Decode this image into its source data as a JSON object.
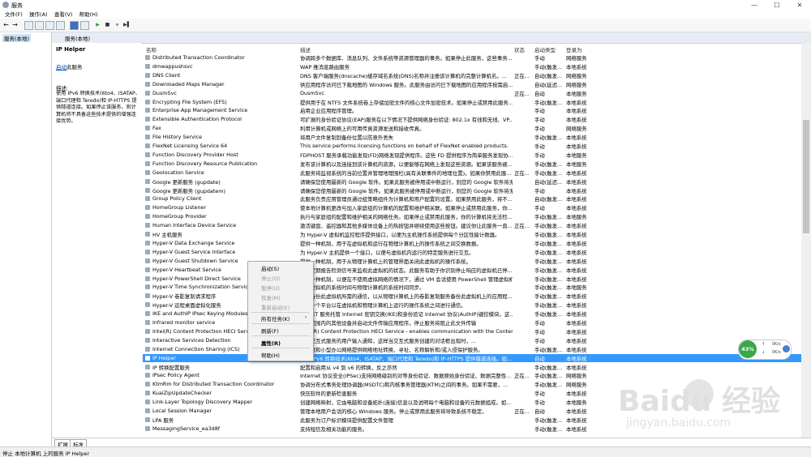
{
  "window": {
    "title": "服务",
    "min": "—",
    "max": "☐",
    "close": "✕"
  },
  "menubar": [
    "文件(F)",
    "操作(A)",
    "查看(V)",
    "帮助(H)"
  ],
  "toolbar": {
    "back": "←",
    "forward": "→",
    "play": "▶",
    "stop": "■",
    "pause": "⏸",
    "restart": "▶▌"
  },
  "tree": {
    "root": "服务(本地)"
  },
  "header": {
    "title": "服务(本地)"
  },
  "desc": {
    "title": "IP Helper",
    "start_link": "启动",
    "start_suffix": "此服务",
    "label": "描述:",
    "body": "使用 IPv6 转换技术(6to4、ISATAP、端口代理和 Teredo)和 IP-HTTPS 提供隧道连接。如果停止该服务，则计算机将不具备这些技术提供的增强连接优势。"
  },
  "columns": {
    "name": "名称",
    "desc": "描述",
    "status": "状态",
    "startup": "启动类型",
    "logon": "登录为"
  },
  "rows": [
    {
      "name": "Distributed Transaction Coordinator",
      "desc": "协调跨多个数据库、消息队列、文件系统等资源管理器的事务。如果停止此服务，这些事务...",
      "status": "",
      "startup": "手动",
      "logon": "网络服务"
    },
    {
      "name": "dmwappushsvc",
      "desc": "WAP 推消息路由服务",
      "status": "",
      "startup": "手动(触发...",
      "logon": "本地系统"
    },
    {
      "name": "DNS Client",
      "desc": "DNS 客户端服务(dnscache)缓存域名系统(DNS)名称并注册该计算机的完整计算机名。...",
      "status": "正在...",
      "startup": "自动(触发...",
      "logon": "网络服务"
    },
    {
      "name": "Downloaded Maps Manager",
      "desc": "供应用程序访问已下载地图的 Windows 服务。此服务由访问已下载地图的应用程序按需启...",
      "status": "",
      "startup": "自动(延迟...",
      "logon": "网络服务"
    },
    {
      "name": "DusmSvc",
      "desc": "DusmSvc",
      "status": "正在...",
      "startup": "自动",
      "logon": "本地服务"
    },
    {
      "name": "Encrypting File System (EFS)",
      "desc": "提供用于在 NTFS 文件系统卷上存储加密文件的核心文件加密技术。如果停止或禁用此服务...",
      "status": "",
      "startup": "手动(触发...",
      "logon": "本地系统"
    },
    {
      "name": "Enterprise App Management Service",
      "desc": "启用企业应用程序管理。",
      "status": "",
      "startup": "手动",
      "logon": "本地系统"
    },
    {
      "name": "Extensible Authentication Protocol",
      "desc": "可扩展的身份验证协议(EAP)服务在以下情况下提供网络身份验证: 802.1x 有线和无线、VP...",
      "status": "",
      "startup": "手动",
      "logon": "本地系统"
    },
    {
      "name": "Fax",
      "desc": "利用计算机或网络上的可用传真资源发送和接收传真。",
      "status": "",
      "startup": "手动",
      "logon": "网络服务"
    },
    {
      "name": "File History Service",
      "desc": "将用户文件复制到备份位置以防意外丢失",
      "status": "",
      "startup": "手动(触发...",
      "logon": "本地系统"
    },
    {
      "name": "FlexNet Licensing Service 64",
      "desc": "This service performs licensing functions on behalf of FlexNet enabled products.",
      "status": "",
      "startup": "手动",
      "logon": "本地系统"
    },
    {
      "name": "Function Discovery Provider Host",
      "desc": "FDPHOST 服务承载功能发现(FD)网络发现提供程序。这些 FD 提供程序为简单服务发现协...",
      "status": "",
      "startup": "手动",
      "logon": "本地服务"
    },
    {
      "name": "Function Discovery Resource Publication",
      "desc": "发布该计算机以及连接到该计算机的资源，以便能够在网络上发现这些资源。如果该服务被...",
      "status": "",
      "startup": "手动(触发...",
      "logon": "本地服务"
    },
    {
      "name": "Geolocation Service",
      "desc": "此服务将监视系统的当前位置并管理地理围栏(具有关联事件的地理位置)。如果你禁用此服...",
      "status": "正在...",
      "startup": "手动(触发...",
      "logon": "本地系统"
    },
    {
      "name": "Google 更新服务 (gupdate)",
      "desc": "请确保您使用最新的 Google 软件。如果此服务被停用或中断运行，则您的 Google 软件将无...",
      "status": "",
      "startup": "自动(延迟...",
      "logon": "本地系统"
    },
    {
      "name": "Google 更新服务 (gupdatem)",
      "desc": "请确保您使用最新的 Google 软件。如果此服务被停用或中断运行，则您的 Google 软件将无...",
      "status": "",
      "startup": "手动",
      "logon": "本地系统"
    },
    {
      "name": "Group Policy Client",
      "desc": "此服务负责应用管理员通过组策略组件为计算机和用户配置的设置。如果禁用此服务，将不...",
      "status": "",
      "startup": "自动(触发...",
      "logon": "本地系统"
    },
    {
      "name": "HomeGroup Listener",
      "desc": "使本地计算机更改与加入家庭组的计算机的配置和维护相关联。如果停止或禁用此服务，你...",
      "status": "",
      "startup": "手动",
      "logon": "本地系统"
    },
    {
      "name": "HomeGroup Provider",
      "desc": "执行与家庭组的配置和维护相关的网络任务。如果停止或禁用此服务，你的计算机将无法检...",
      "status": "",
      "startup": "手动(触发...",
      "logon": "本地服务"
    },
    {
      "name": "Human Interface Device Service",
      "desc": "激活键盘、遥控器和其他多媒体设备上的热按钮并继续使用这些按钮。建议你让此服务一直...",
      "status": "正在...",
      "startup": "手动(触发...",
      "logon": "本地系统"
    },
    {
      "name": "HV 主机服务",
      "desc": "为 Hyper-V 虚拟机监控程序提供接口，以便为主机操作系统提供每个分区性能计数器。",
      "status": "",
      "startup": "手动(触发...",
      "logon": "本地系统"
    },
    {
      "name": "Hyper-V Data Exchange Service",
      "desc": "提供一种机制，用于在虚拟机和运行在物理计算机上的操作系统之间交换数据。",
      "status": "",
      "startup": "手动(触发...",
      "logon": "本地系统"
    },
    {
      "name": "Hyper-V Guest Service Interface",
      "desc": "为 Hyper-V 主机提供一个接口，以便与虚拟机内运行的特定服务进行交互。",
      "status": "",
      "startup": "手动(触发...",
      "logon": "本地系统"
    },
    {
      "name": "Hyper-V Guest Shutdown Service",
      "desc": "提供一种机制，用于从物理计算机上的管理界面关闭此虚拟机的操作系统。",
      "status": "",
      "startup": "手动(触发...",
      "logon": "本地系统"
    },
    {
      "name": "Hyper-V Heartbeat Service",
      "desc": "通过定期报告检测信号来监视此虚拟机的状态。此服务有助于你识别停止响应的虚拟机已停...",
      "status": "",
      "startup": "手动(触发...",
      "logon": "本地系统"
    },
    {
      "name": "Hyper-V PowerShell Direct Service",
      "desc": "提供一种机制，以便在不使用虚拟网络的情况下，通过 VM 会话使用 PowerShell 管理虚拟机的机制...",
      "status": "",
      "startup": "手动(触发...",
      "logon": "本地系统"
    },
    {
      "name": "Hyper-V Time Synchronization Service",
      "desc": "将此虚拟机的系统时间与物理计算机的系统时间同步。",
      "status": "",
      "startup": "手动(触发...",
      "logon": "本地服务"
    },
    {
      "name": "Hyper-V 卷影复制请求程序",
      "desc": "协调备份此虚拟机所需的通信，以从物理计算机上的卷影复制服务备份此虚拟机上的应用程...",
      "status": "",
      "startup": "手动(触发...",
      "logon": "本地系统"
    },
    {
      "name": "Hyper-V 远程桌面虚拟化服务",
      "desc": "提供一个平台以在虚拟机和物理计算机上运行的操作系统之间进行通信。",
      "status": "",
      "startup": "手动(触发...",
      "logon": "本地系统"
    },
    {
      "name": "IKE and AuthIP IPsec Keying Modules",
      "desc": "IKEEXT 服务托管 Internet 密钥交换(IKE)和身份验证 Internet 协议(AuthIP)键控模块。这...",
      "status": "",
      "startup": "手动(触发...",
      "logon": "本地系统"
    },
    {
      "name": "Infrared monitor service",
      "desc": "检测范围内的其他设备并启动文件传输应用程序。停止服务将阻止此文件传输",
      "status": "",
      "startup": "手动",
      "logon": "本地系统"
    },
    {
      "name": "Intel(R) Content Protection HECI Service",
      "desc": "Intel(R) Content Protection HECI Service - enables communication with the Content ...",
      "status": "",
      "startup": "手动",
      "logon": "本地系统"
    },
    {
      "name": "Interactive Services Detection",
      "desc": "启用交互式服务的用户输入通知，这样当交互式服务创建的对话框出现时，...",
      "status": "",
      "startup": "手动",
      "logon": "本地系统"
    },
    {
      "name": "Internet Connection Sharing (ICS)",
      "desc": "为家庭和小型办公网络提供网络地址转换、寻址、名称解析和/或入侵保护服务。",
      "status": "",
      "startup": "手动(触发...",
      "logon": "本地系统"
    },
    {
      "name": "IP Helper",
      "desc": "使用 IPv6 转换技术(6to4、ISATAP、端口代理和 Teredo)和 IP-HTTPS 提供隧道连接。如...",
      "status": "",
      "startup": "自动",
      "logon": "本地系统"
    },
    {
      "name": "IP 转换配置服务",
      "desc": "配置和启用从 v4 到 v6 的转换，反之亦然",
      "status": "",
      "startup": "手动(触发...",
      "logon": "本地系统"
    },
    {
      "name": "IPsec Policy Agent",
      "desc": "Internet 协议安全(IPSec)支持网络级别的对等身份验证、数据原始身份验证、数据完整性...",
      "status": "正在...",
      "startup": "手动(触发...",
      "logon": "网络服务"
    },
    {
      "name": "KtmRm for Distributed Transaction Coordinator",
      "desc": "协调分布式事务处理协调器(MSDTC)和内核事务管理器(KTM)之间的事务。如果不需要，...",
      "status": "",
      "startup": "手动(触发...",
      "logon": "网络服务"
    },
    {
      "name": "KuaiZipUpdateChecker",
      "desc": "快压软件的更新检查服务",
      "status": "",
      "startup": "手动",
      "logon": "本地系统"
    },
    {
      "name": "Link-Layer Topology Discovery Mapper",
      "desc": "创建网络映射，它由电脑和设备拓扑(连接)信息以及说明每个电脑和设备的元数据组成。如...",
      "status": "",
      "startup": "手动",
      "logon": "本地服务"
    },
    {
      "name": "Local Session Manager",
      "desc": "管理本地用户会话的核心 Windows 服务。停止或禁用此服务将导致系统不稳定。",
      "status": "正在...",
      "startup": "自动",
      "logon": "本地系统"
    },
    {
      "name": "LPA 服务",
      "desc": "此服务为订户标识模块提供配置文件管理",
      "status": "",
      "startup": "手动(触发...",
      "logon": "本地系统"
    },
    {
      "name": "MessagingService_ea3d8f",
      "desc": "支持短信及相关功能的服务。",
      "status": "",
      "startup": "手动(触发...",
      "logon": "本地系统"
    }
  ],
  "context_menu": {
    "start": "启动(S)",
    "stop": "停止(O)",
    "pause": "暂停(U)",
    "resume": "恢复(M)",
    "restart": "重新启动(E)",
    "all_tasks": "所有任务(K)",
    "refresh": "刷新(F)",
    "properties": "属性(R)",
    "help": "帮助(H)"
  },
  "tabs": {
    "extended": "扩展",
    "standard": "标准"
  },
  "status_bar": "停止 本地计算机 上的服务 IP Helper",
  "widget": {
    "percent": "43%",
    "up_value": "0K/s",
    "down_value": "0K/s"
  },
  "watermark": {
    "brand": "Baidu 经验",
    "url": "jingyan.baidu.com"
  },
  "colors": {
    "selection": "#3399ff",
    "gauge": "#3aa84a"
  }
}
